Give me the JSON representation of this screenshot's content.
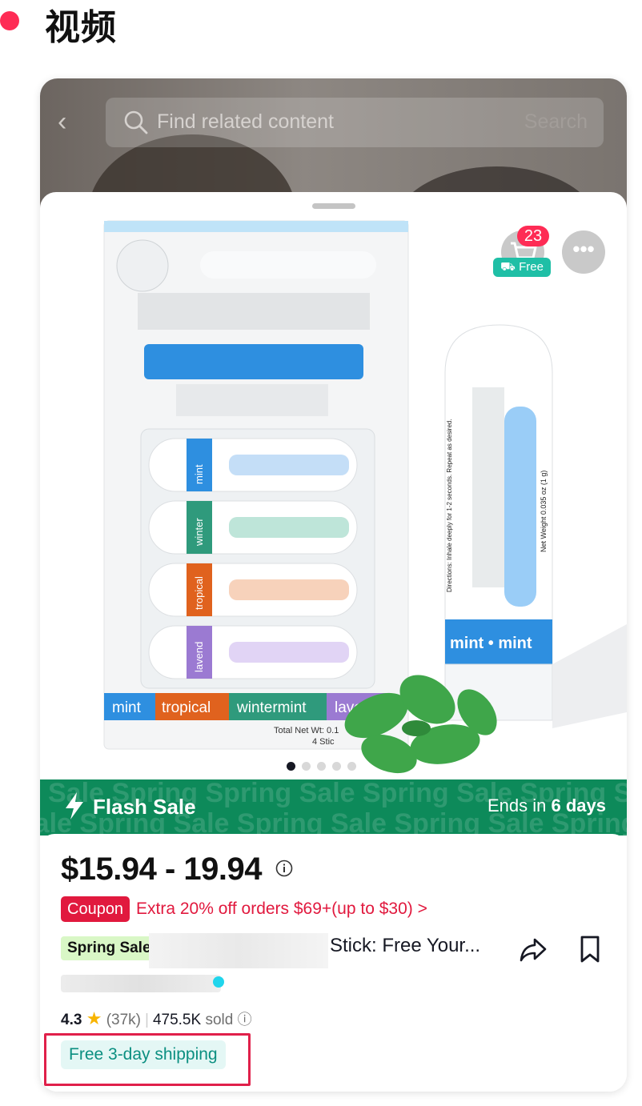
{
  "header": {
    "title": "视频"
  },
  "search": {
    "placeholder": "Find related content",
    "button_label": "Search"
  },
  "cart": {
    "count": "23",
    "free_label": "Free"
  },
  "product_image": {
    "pack_labels": [
      "mint",
      "tropical",
      "wintermint",
      "laverd"
    ],
    "tube_side_labels": [
      "mint",
      "winter",
      "tropical",
      "lavend"
    ],
    "net_weight_label": "Total Net Wt: 0.1",
    "stick_count_label": "4 Stic",
    "tube_label": "mint  •  mint",
    "tube_weight": "Net Weight 0.035 oz (1 g)",
    "tube_directions": "Directions: Inhale deeply for 1-2 seconds. Repeat as desired.",
    "pagination": {
      "total": 5,
      "active": 0
    }
  },
  "flash_sale": {
    "label": "Flash Sale",
    "ends_prefix": "Ends in",
    "ends_value": "6 days",
    "watermark": "Spring Sale"
  },
  "product": {
    "price": "$15.94 - 19.94",
    "coupon_tag": "Coupon",
    "coupon_text": "Extra 20% off orders $69+(up to $30) >",
    "promo_tag": "Spring Sale",
    "title_tail": "Stick: Free Your...",
    "rating": "4.3",
    "reviews": "(37k)",
    "sold": "475.5K",
    "sold_label": "sold",
    "shipping": "Free 3-day shipping"
  },
  "colors": {
    "accent": "#fe2c55",
    "flash_green": "#0d8a5a",
    "coupon_red": "#e1193e",
    "shipping_teal": "#0b8f81",
    "mint_blue": "#2e8fe0",
    "tropical_orange": "#e0621e",
    "wintermint_green": "#2f9a7c",
    "lavender_purple": "#9b7ad2"
  },
  "icons": [
    "back-icon",
    "search-icon",
    "cart-icon",
    "truck-icon",
    "more-icon",
    "info-icon",
    "bolt-icon",
    "star-icon",
    "share-icon",
    "bookmark-icon"
  ]
}
